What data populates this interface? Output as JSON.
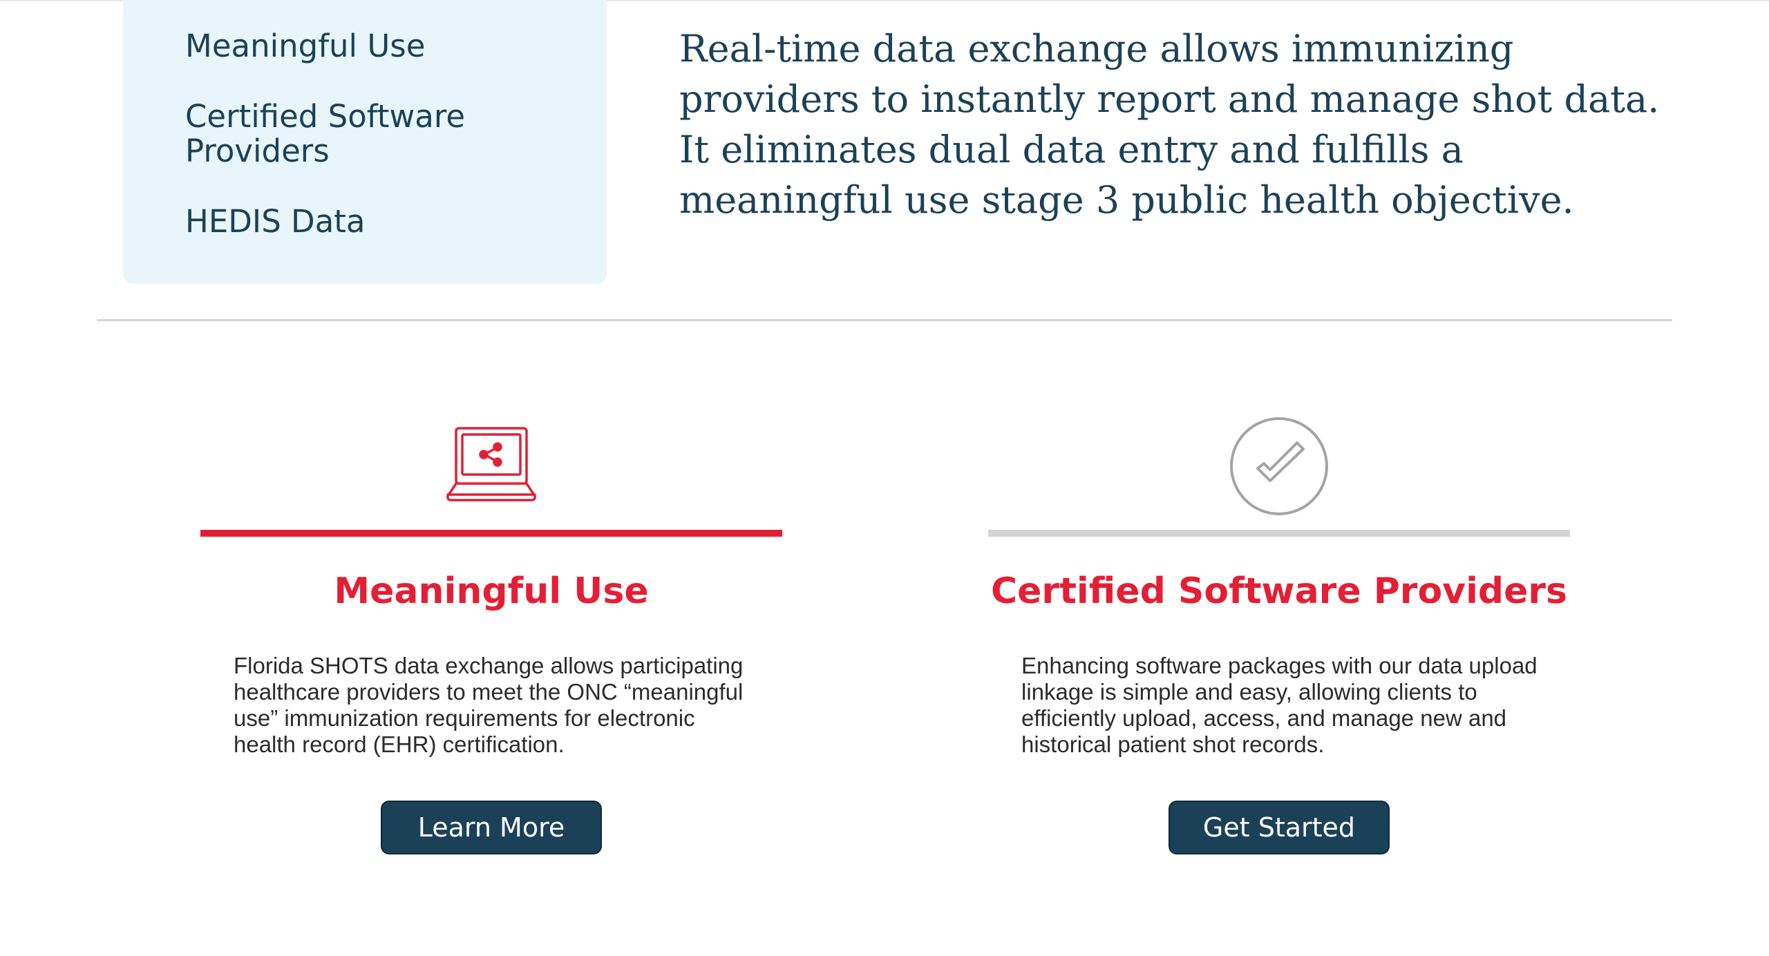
{
  "quick_links": [
    {
      "label": "Meaningful Use"
    },
    {
      "label": "Certified Software Providers"
    },
    {
      "label": "HEDIS Data"
    }
  ],
  "intro": {
    "text": "Real-time data exchange allows immunizing providers to instantly report and manage shot data. It eliminates dual data entry and fulfills a meaningful use stage 3 public health objective."
  },
  "cards": [
    {
      "icon": "laptop-share-icon",
      "title": "Meaningful Use",
      "description": "Florida SHOTS data exchange allows participating healthcare providers to meet the ONC “meaningful use” immunization requirements for electronic health record (EHR) certification.",
      "button": "Learn More",
      "bar_color": "#e41f35"
    },
    {
      "icon": "circle-check-icon",
      "title": "Certified Software Providers",
      "description": "Enhancing software packages with our data upload linkage is simple and easy, allowing clients to efficiently upload, access, and manage new and historical patient shot records.",
      "button": "Get Started",
      "bar_color": "#d4d4d4"
    }
  ],
  "colors": {
    "navy": "#1b4157",
    "accent_red": "#e41f35",
    "panel_bg": "#e8f5fa",
    "divider": "#d4d6d8"
  }
}
